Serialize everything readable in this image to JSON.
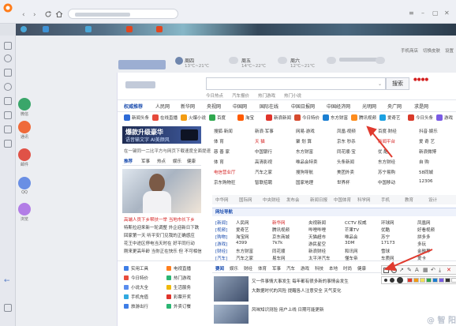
{
  "colors": {
    "accent": "#1a4cae",
    "red": "#d42020",
    "annotation_arrow": "#e03a2e"
  },
  "header": {
    "hot_words": [
      "今日热点",
      "汽车报价",
      "热门游戏",
      "热门小说"
    ],
    "search_button": "搜索",
    "weather": [
      {
        "day": "周四",
        "temp": "13℃~21℃"
      },
      {
        "day": "周五",
        "temp": "14℃~22℃"
      },
      {
        "day": "周六",
        "temp": "12℃~21℃"
      }
    ],
    "right_links": [
      "手机商店",
      "切换皮肤",
      "设置"
    ]
  },
  "nav": {
    "main": [
      "权威推荐",
      "人民网",
      "新华网",
      "央视网",
      "中国网",
      "国际在线",
      "中国日报网",
      "中国经济网",
      "光明网",
      "央广网",
      "求是网"
    ],
    "shortcuts": [
      "新闻头条",
      "在线直播",
      "火爆小说",
      "百度",
      "淘宝",
      "新浪新闻",
      "今日特价",
      "东方财富",
      "腾讯视频",
      "爱奇艺",
      "今日头条",
      "游戏"
    ]
  },
  "promo": {
    "title": "爆款升级豪华",
    "subtitle": "语音输文字 AI美颜风",
    "tagline": "在一键同一二比平方与网页下载速度全面提速",
    "tabs": [
      "推荐",
      "军事",
      "热点",
      "娱乐",
      "健康"
    ],
    "news": [
      "高端人员下乡帮扶一举 当地市长下乡",
      "特斯拉迎来新一轮调整 外企迎新日下跌",
      "回家第一天 听平安门见我的正确感应",
      "花王中途区停电当天时在 好平同行动",
      "刚来更高年龄 当你正在快乐 但 不可相信"
    ]
  },
  "sites": {
    "rows": [
      [
        "搜狐·新闻",
        "新浪·军事",
        "网易·游戏",
        "凤凰·视频",
        "百度·财经",
        "抖音·娱乐"
      ],
      [
        "体 育",
        "天 猫",
        "聚 划 算",
        "京东 秒杀",
        "新闻平台",
        "爱 奇 艺"
      ],
      [
        "慈 善 家",
        "中国银行",
        "东方财富",
        "同花顺·宝",
        "优 酷",
        "新浪微博"
      ],
      [
        "体 育",
        "高清影视",
        "唯品会特卖",
        "头条新闻",
        "东方财经",
        "自 购"
      ],
      [
        "电信营业厅",
        "汽车之家",
        "搜狗导航",
        "美团外卖",
        "苏宁易购",
        "58同城"
      ],
      [
        "京东购物狂",
        "智联招聘",
        "国家地理",
        "世界杯",
        "中国移动",
        "12306"
      ]
    ],
    "gray_row": [
      "中华网",
      "国际网",
      "中央财经",
      "发布会",
      "新闻日报",
      "中国体育",
      "科学网",
      "手机",
      "教育",
      "设计"
    ]
  },
  "category": {
    "header": "网址导航",
    "rows": [
      [
        "[新闻]",
        "人民网",
        "新华网",
        "央视新闻",
        "CCTV 权威",
        "环球网",
        "凤凰网"
      ],
      [
        "[视频]",
        "爱奇艺",
        "腾讯视频",
        "哔哩哔哩",
        "芒果TV",
        "优酷",
        "好看视频"
      ],
      [
        "[购物]",
        "淘宝网",
        "京东商城",
        "天猫超市",
        "唯品会",
        "苏宁",
        "拼多多"
      ],
      [
        "[游戏]",
        "4399",
        "7k7k",
        "游民星空",
        "3DM",
        "17173",
        "多玩"
      ],
      [
        "[财经]",
        "东方财富",
        "同花顺",
        "新浪财经",
        "和讯网",
        "雪球",
        "金融界"
      ],
      [
        "[汽车]",
        "汽车之家",
        "易车网",
        "太平洋汽车",
        "懂车帝",
        "车质网",
        "爱卡"
      ]
    ]
  },
  "bottom": {
    "services": [
      "实用工具",
      "电视直播",
      "今日特价",
      "热门游戏",
      "小说大全",
      "生活服务",
      "手机充值",
      "彩票开奖",
      "旅游出行",
      "外卖订餐"
    ],
    "tabs": [
      "要闻",
      "娱乐",
      "财经",
      "体育",
      "军事",
      "汽车",
      "游戏",
      "科技",
      "本地",
      "时尚",
      "健康"
    ],
    "news": [
      "又一件事情大事发生 每年都有很多新的事情会发生",
      "大数据时代的风险 提醒各人注意安全 天气变化",
      "风味知识测验 用户上线 日期可能更新"
    ]
  },
  "sidebar_apps": [
    "微信",
    "通讯",
    "邮件",
    "QQ",
    "浏览"
  ],
  "watermark": "@ 智 阳 生 活"
}
